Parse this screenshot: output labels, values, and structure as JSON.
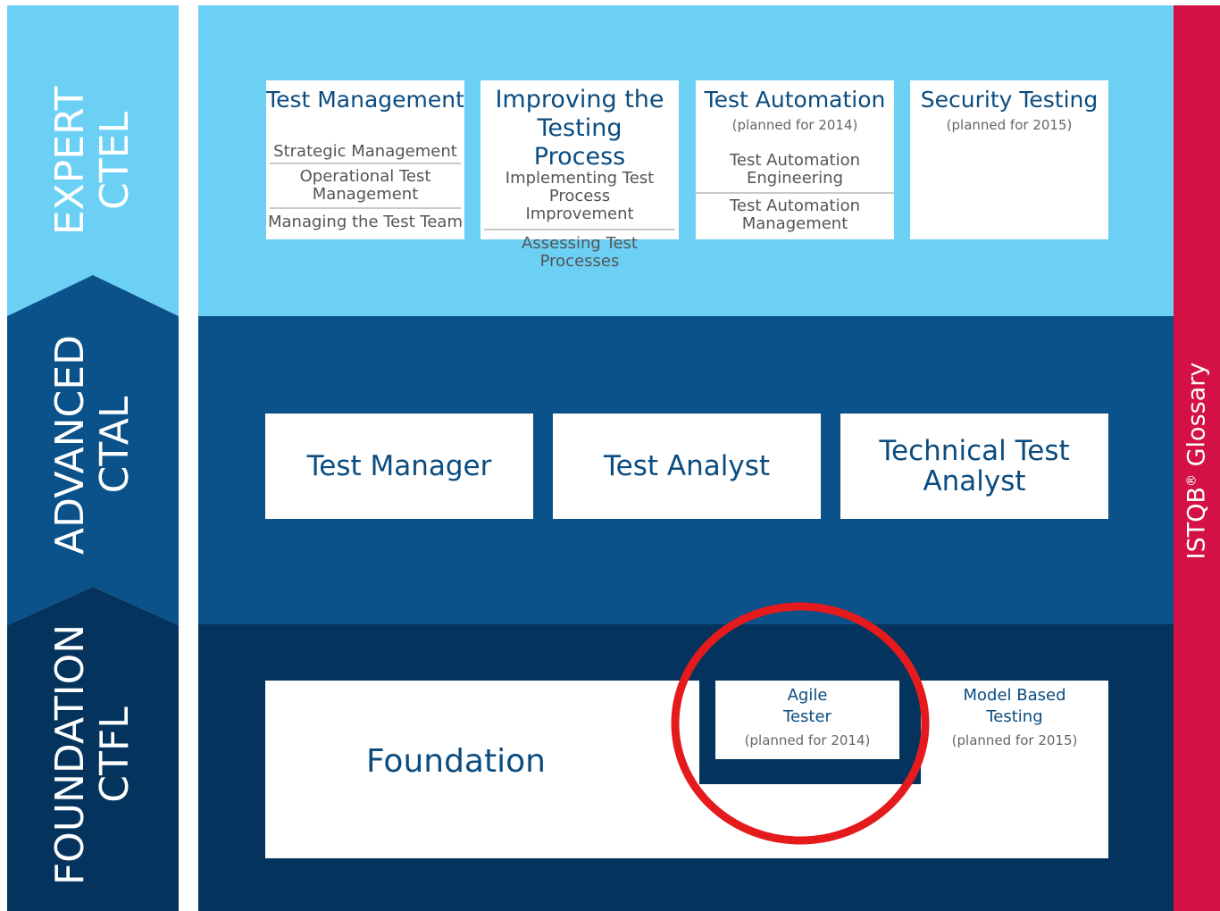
{
  "levels": {
    "expert": {
      "name": "EXPERT",
      "code": "CTEL"
    },
    "advanced": {
      "name": "ADVANCED",
      "code": "CTAL"
    },
    "foundation": {
      "name": "FOUNDATION",
      "code": "CTFL"
    }
  },
  "glossary": {
    "label": "ISTQB",
    "mark": "®",
    "suffix": " Glossary"
  },
  "expert_modules": [
    {
      "title": "Test Management",
      "items": [
        "Strategic Management",
        "Operational Test Management",
        "Managing the Test Team"
      ]
    },
    {
      "title": "Improving the Testing Process",
      "items": [
        "Implementing Test Process Improvement",
        "Assessing Test Processes"
      ]
    },
    {
      "title": "Test Automation",
      "planned": "(planned for 2014)",
      "items": [
        "Test Automation Engineering",
        "Test Automation Management"
      ]
    },
    {
      "title": "Security Testing",
      "planned": "(planned for 2015)",
      "items": []
    }
  ],
  "advanced_modules": [
    "Test Manager",
    "Test Analyst",
    "Technical Test Analyst"
  ],
  "foundation": {
    "title": "Foundation",
    "extensions": [
      {
        "title": "Agile Tester",
        "planned": "(planned for 2014)"
      },
      {
        "title": "Model Based Testing",
        "planned": "(planned for 2015)"
      }
    ]
  },
  "colors": {
    "expert": "#6cd0f5",
    "advanced": "#0a5289",
    "foundation": "#04345e",
    "glossary": "#d31145",
    "highlight_circle": "#e41a1c"
  }
}
